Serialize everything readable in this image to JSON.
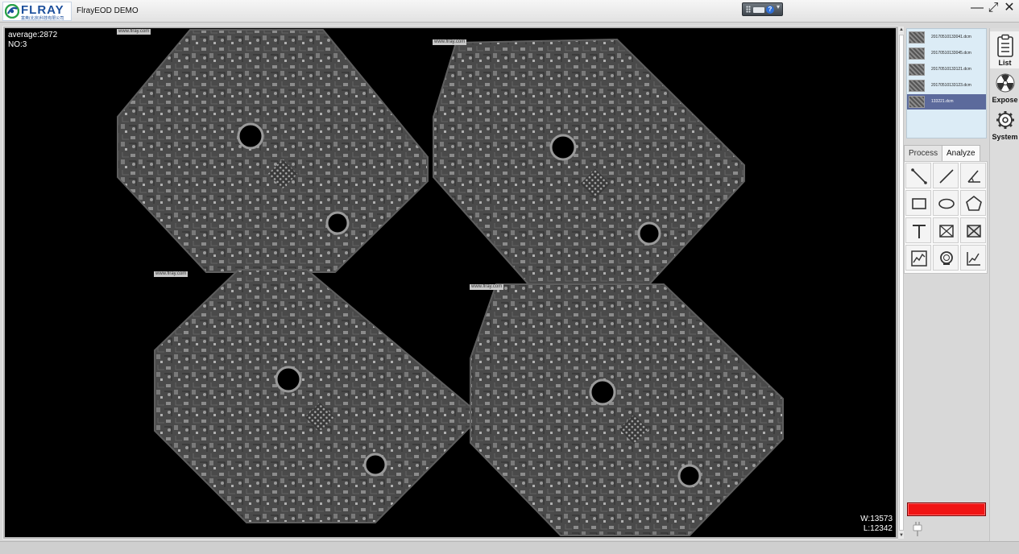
{
  "app": {
    "logo_text": "FLRAY",
    "logo_subtitle": "富奥(北京)科技有限公司",
    "title": "FlrayEOD DEMO"
  },
  "window_controls": {
    "minimize": "—",
    "restore": "⤢",
    "close": "✕"
  },
  "toolbar_widget": {
    "help": "?",
    "arrow": "▾"
  },
  "viewport": {
    "average_label": "average:2872",
    "no_label": "NO:3",
    "width_label": "W:13573",
    "level_label": "L:12342",
    "watermarks": [
      "www.flray.com",
      "www.flray.com",
      "www.flray.com",
      "www.flray.com"
    ]
  },
  "file_list": {
    "files": [
      {
        "name": "20170510133041.dcm",
        "selected": false
      },
      {
        "name": "20170510133045.dcm",
        "selected": false
      },
      {
        "name": "20170510133121.dcm",
        "selected": false
      },
      {
        "name": "20170510133123.dcm",
        "selected": false
      },
      {
        "name": "133221.dcm",
        "selected": true
      }
    ]
  },
  "side_tools": [
    {
      "label": "List",
      "icon": "clipboard-list-icon"
    },
    {
      "label": "Expose",
      "icon": "radiation-icon"
    },
    {
      "label": "System",
      "icon": "gear-icon"
    }
  ],
  "tabs": [
    {
      "label": "Process",
      "active": false
    },
    {
      "label": "Analyze",
      "active": true
    }
  ],
  "analyze_tools": [
    "line-measure-icon",
    "line-icon",
    "angle-icon",
    "rectangle-icon",
    "ellipse-icon",
    "pentagon-icon",
    "text-icon",
    "crossed-box-icon",
    "crossed-box-filled-icon",
    "profile-chart-icon",
    "magnifier-icon",
    "histogram-icon"
  ],
  "colors": {
    "status_indicator": "#f01414",
    "selected_file": "#5c6a9c",
    "file_list_bg": "#dcecf6",
    "brand": "#1c4f9c"
  }
}
